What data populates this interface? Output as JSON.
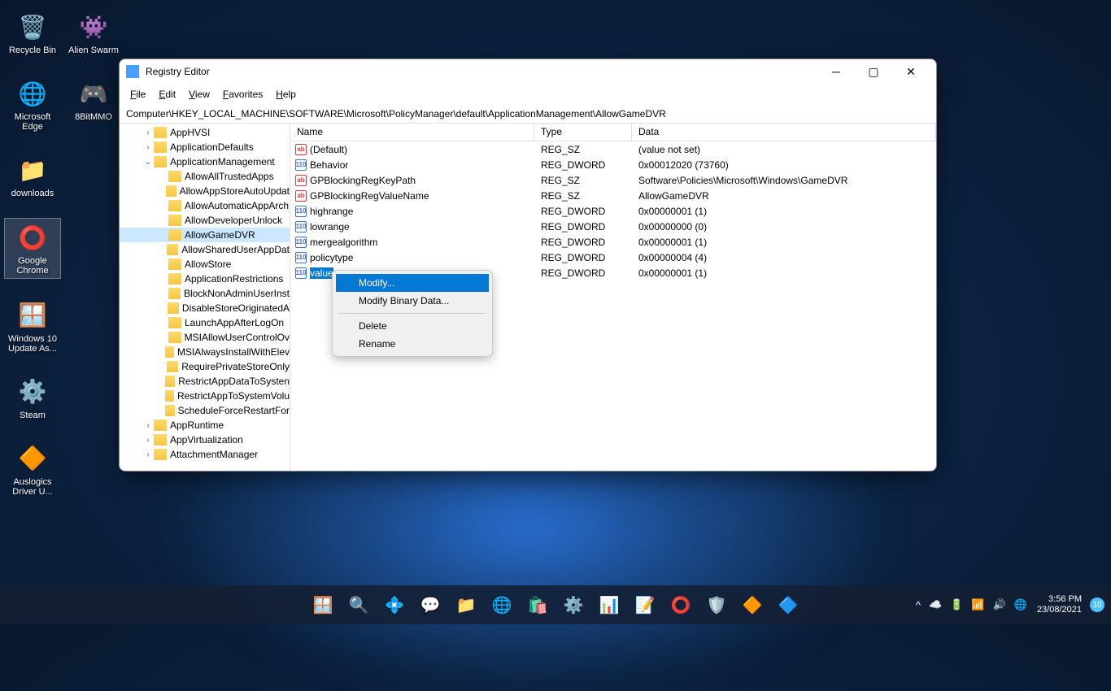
{
  "desktop": {
    "col1": [
      {
        "label": "Recycle Bin",
        "icon": "🗑️"
      },
      {
        "label": "Microsoft Edge",
        "icon": "🌐"
      },
      {
        "label": "downloads",
        "icon": "📁"
      },
      {
        "label": "Google Chrome",
        "icon": "⭕",
        "selected": true
      },
      {
        "label": "Windows 10 Update As...",
        "icon": "🪟"
      },
      {
        "label": "Steam",
        "icon": "⚙️"
      },
      {
        "label": "Auslogics Driver U...",
        "icon": "🔶"
      }
    ],
    "col2": [
      {
        "label": "Alien Swarm",
        "icon": "👾"
      },
      {
        "label": "8BitMMO",
        "icon": "🎮"
      }
    ]
  },
  "window": {
    "title": "Registry Editor",
    "menus": [
      "File",
      "Edit",
      "View",
      "Favorites",
      "Help"
    ],
    "address": "Computer\\HKEY_LOCAL_MACHINE\\SOFTWARE\\Microsoft\\PolicyManager\\default\\ApplicationManagement\\AllowGameDVR",
    "columns": {
      "name": "Name",
      "type": "Type",
      "data": "Data"
    },
    "tree": [
      {
        "label": "AppHVSI",
        "indent": 28,
        "chevron": "›"
      },
      {
        "label": "ApplicationDefaults",
        "indent": 28,
        "chevron": "›"
      },
      {
        "label": "ApplicationManagement",
        "indent": 28,
        "chevron": "⌄",
        "expanded": true
      },
      {
        "label": "AllowAllTrustedApps",
        "indent": 46
      },
      {
        "label": "AllowAppStoreAutoUpdat",
        "indent": 46
      },
      {
        "label": "AllowAutomaticAppArch",
        "indent": 46
      },
      {
        "label": "AllowDeveloperUnlock",
        "indent": 46
      },
      {
        "label": "AllowGameDVR",
        "indent": 46,
        "selected": true
      },
      {
        "label": "AllowSharedUserAppDat",
        "indent": 46
      },
      {
        "label": "AllowStore",
        "indent": 46
      },
      {
        "label": "ApplicationRestrictions",
        "indent": 46
      },
      {
        "label": "BlockNonAdminUserInst",
        "indent": 46
      },
      {
        "label": "DisableStoreOriginatedA",
        "indent": 46
      },
      {
        "label": "LaunchAppAfterLogOn",
        "indent": 46
      },
      {
        "label": "MSIAllowUserControlOv",
        "indent": 46
      },
      {
        "label": "MSIAlwaysInstallWithElev",
        "indent": 46
      },
      {
        "label": "RequirePrivateStoreOnly",
        "indent": 46
      },
      {
        "label": "RestrictAppDataToSysten",
        "indent": 46
      },
      {
        "label": "RestrictAppToSystemVolu",
        "indent": 46
      },
      {
        "label": "ScheduleForceRestartFor",
        "indent": 46
      },
      {
        "label": "AppRuntime",
        "indent": 28,
        "chevron": "›"
      },
      {
        "label": "AppVirtualization",
        "indent": 28,
        "chevron": "›"
      },
      {
        "label": "AttachmentManager",
        "indent": 28,
        "chevron": "›"
      }
    ],
    "values": [
      {
        "name": "(Default)",
        "type": "REG_SZ",
        "data": "(value not set)",
        "kind": "sz"
      },
      {
        "name": "Behavior",
        "type": "REG_DWORD",
        "data": "0x00012020 (73760)",
        "kind": "dw"
      },
      {
        "name": "GPBlockingRegKeyPath",
        "type": "REG_SZ",
        "data": "Software\\Policies\\Microsoft\\Windows\\GameDVR",
        "kind": "sz"
      },
      {
        "name": "GPBlockingRegValueName",
        "type": "REG_SZ",
        "data": "AllowGameDVR",
        "kind": "sz"
      },
      {
        "name": "highrange",
        "type": "REG_DWORD",
        "data": "0x00000001 (1)",
        "kind": "dw"
      },
      {
        "name": "lowrange",
        "type": "REG_DWORD",
        "data": "0x00000000 (0)",
        "kind": "dw"
      },
      {
        "name": "mergealgorithm",
        "type": "REG_DWORD",
        "data": "0x00000001 (1)",
        "kind": "dw"
      },
      {
        "name": "policytype",
        "type": "REG_DWORD",
        "data": "0x00000004 (4)",
        "kind": "dw"
      },
      {
        "name": "value",
        "type": "REG_DWORD",
        "data": "0x00000001 (1)",
        "kind": "dw",
        "selected": true
      }
    ]
  },
  "contextMenu": {
    "items": [
      {
        "label": "Modify...",
        "highlighted": true
      },
      {
        "label": "Modify Binary Data..."
      },
      {
        "sep": true
      },
      {
        "label": "Delete"
      },
      {
        "label": "Rename"
      }
    ]
  },
  "taskbar": {
    "center": [
      "🪟",
      "🔍",
      "💠",
      "💬",
      "📁",
      "🌐",
      "🛍️",
      "⚙️",
      "📊",
      "📝",
      "⭕",
      "🛡️",
      "🔶",
      "🔷"
    ],
    "tray": [
      "^",
      "☁️",
      "🔋",
      "📶",
      "🔊",
      "🌐"
    ],
    "time": "3:56 PM",
    "date": "23/08/2021",
    "notif": "10"
  }
}
